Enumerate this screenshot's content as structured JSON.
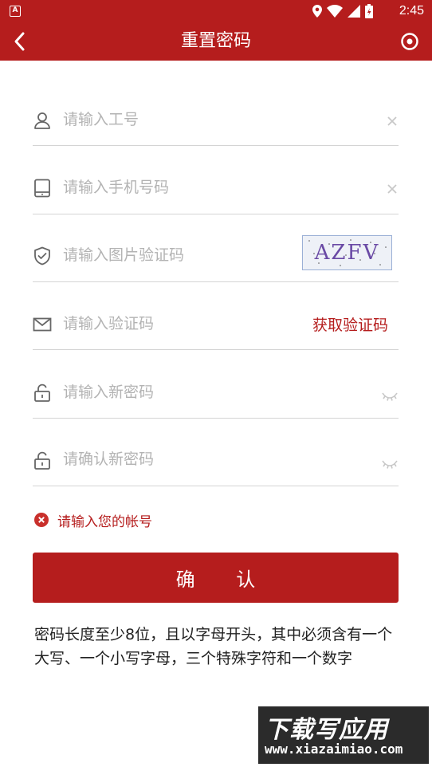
{
  "status_bar": {
    "app_badge": "A",
    "time": "2:45"
  },
  "nav": {
    "title": "重置密码",
    "icons": {
      "back": "chevron-left-icon",
      "more": "target-icon"
    }
  },
  "fields": [
    {
      "placeholder": "请输入工号",
      "icon": "user-icon",
      "trailing": "clear"
    },
    {
      "placeholder": "请输入手机号码",
      "icon": "tablet-icon",
      "trailing": "clear"
    },
    {
      "placeholder": "请输入图片验证码",
      "icon": "shield-check-icon",
      "trailing": "captcha"
    },
    {
      "placeholder": "请输入验证码",
      "icon": "mail-icon",
      "trailing": "get-code"
    },
    {
      "placeholder": "请输入新密码",
      "icon": "lock-icon",
      "trailing": "eye-closed"
    },
    {
      "placeholder": "请确认新密码",
      "icon": "lock-icon",
      "trailing": "eye-closed"
    }
  ],
  "captcha": {
    "text": "AZFV"
  },
  "get_code_label": "获取验证码",
  "error": {
    "message": "请输入您的帐号",
    "icon": "error-circle-icon"
  },
  "confirm_button": "确 认",
  "hint": "密码长度至少8位，且以字母开头，其中必须含有一个大写、一个小写字母，三个特殊字符和一个数字",
  "watermark": {
    "line1": "下载写应用",
    "line2": "www.xiazaimiao.com"
  },
  "colors": {
    "accent": "#b51d1d",
    "placeholder": "#b3b3b3",
    "divider": "#d4d4d4"
  }
}
